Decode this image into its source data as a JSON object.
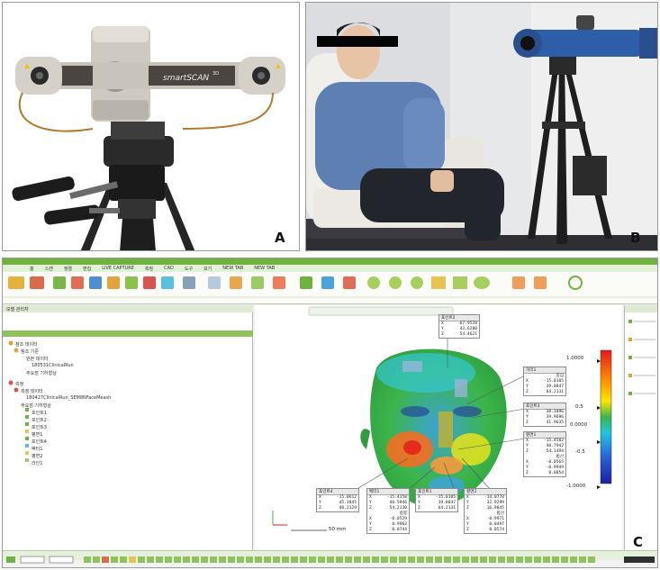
{
  "panel_a": {
    "letter": "A",
    "device_brand": "smartSCAN",
    "device_brand_sup": "3D"
  },
  "panel_b": {
    "letter": "B"
  },
  "panel_c": {
    "letter": "C",
    "scale_max": "1.0000",
    "scale_min": "-1.0000",
    "scale_mid_pos": "0.5",
    "scale_mid_neg": "-0.5",
    "scale_zero": "0.0000",
    "scalebar_label": "50 mm",
    "ribbon_tabs": [
      "홈",
      "스캔",
      "정렬",
      "편집",
      "LIVE CAPTURE",
      "측정",
      "CAD",
      "도구",
      "보기",
      "NEW TAB",
      "NEW TAB"
    ],
    "tree_title": "모델 관리자",
    "tree_rows": [
      "참조 데이터",
      "참조 기준",
      "원본 데이터",
      "180531ClinicalRun",
      "주요점 기하형상",
      "측정",
      "측정 데이터",
      "180427ClinicalRun_SEM8NFaceMeash",
      "주요점 기하형상",
      "포인트1",
      "포인트2",
      "포인트3",
      "평면1",
      "포인트4",
      "벡터1",
      "평면2",
      "라인1"
    ],
    "callouts": [
      {
        "title": "포인트2",
        "rows": [
          [
            "X",
            "-67.9520"
          ],
          [
            "Y",
            "43.6280"
          ],
          [
            "Z",
            "54.4621"
          ]
        ]
      },
      {
        "title": "거리1",
        "rows": [
          [
            "",
            "중심"
          ],
          [
            "X",
            "-15.0105"
          ],
          [
            "Y",
            "39.8847"
          ],
          [
            "Z",
            "64.2131"
          ]
        ]
      },
      {
        "title": "포인트3",
        "rows": [
          [
            "X",
            "38.1896"
          ],
          [
            "Y",
            "39.9696"
          ],
          [
            "Z",
            "41.9635"
          ]
        ]
      },
      {
        "title": "평면1",
        "rows": [
          [
            "X",
            "-15.4502"
          ],
          [
            "Y",
            "40.7942"
          ],
          [
            "Z",
            "54.1494"
          ],
          [
            "",
            "법선"
          ],
          [
            "X",
            "-0.0565"
          ],
          [
            "Y",
            "-0.9949"
          ],
          [
            "Z",
            "0.0854"
          ]
        ]
      },
      {
        "title": "포인트4",
        "rows": [
          [
            "X",
            "-15.0612"
          ],
          [
            "Y",
            "45.3845"
          ],
          [
            "Z",
            "40.2129"
          ]
        ]
      },
      {
        "title": "벡터1",
        "rows": [
          [
            "X",
            "-15.4358"
          ],
          [
            "Y",
            "40.5946"
          ],
          [
            "Z",
            "54.2130"
          ],
          [
            "",
            "방향"
          ],
          [
            "X",
            "-0.0529"
          ],
          [
            "Y",
            "0.9963"
          ],
          [
            "Z",
            "0.0744"
          ]
        ]
      },
      {
        "title": "포인트1",
        "rows": [
          [
            "X",
            "-15.0105"
          ],
          [
            "Y",
            "39.8847"
          ],
          [
            "Z",
            "64.2131"
          ]
        ]
      },
      {
        "title": "평면2",
        "rows": [
          [
            "X",
            "-14.0770"
          ],
          [
            "Y",
            "32.9299"
          ],
          [
            "Z",
            "16.9845"
          ],
          [
            "",
            "법선"
          ],
          [
            "X",
            "-0.9971"
          ],
          [
            "Y",
            "0.0497"
          ],
          [
            "Z",
            "0.0574"
          ]
        ]
      }
    ]
  }
}
